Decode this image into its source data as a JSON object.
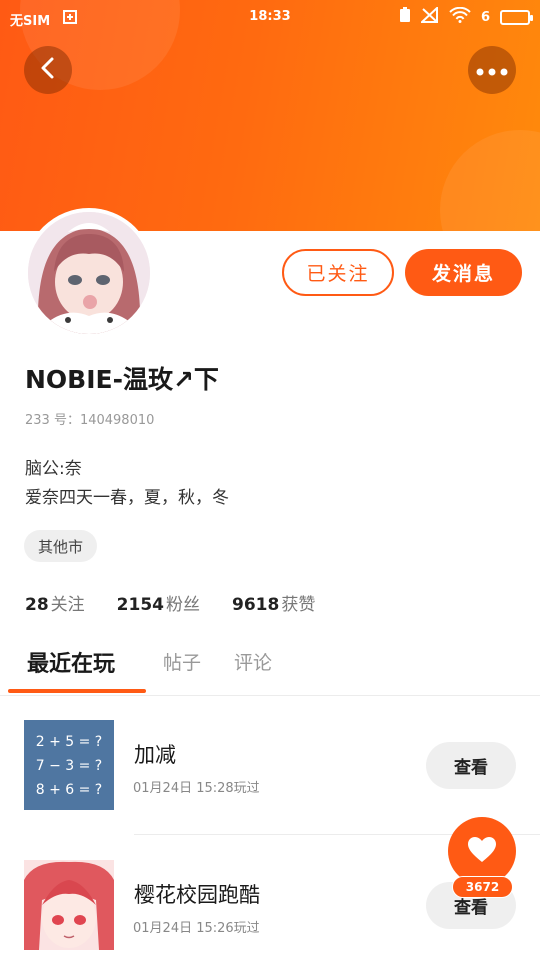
{
  "status_bar": {
    "carrier": "无SIM",
    "time": "18:33",
    "battery_level": "6"
  },
  "profile": {
    "username": "NOBIE-温玫↗下",
    "uid": "233 号：140498010",
    "bio_line1": "脑公:奈",
    "bio_line2": "爱奈四天一春，夏，秋，冬",
    "location": "其他市",
    "follow_count": "28",
    "follow_label": "关注",
    "fans_count": "2154",
    "fans_label": "粉丝",
    "likes_count": "9618",
    "likes_label": "获赞"
  },
  "actions": {
    "followed_label": "已关注",
    "message_label": "发消息"
  },
  "tabs": [
    {
      "label": "最近在玩",
      "active": true
    },
    {
      "label": "帖子",
      "active": false
    },
    {
      "label": "评论",
      "active": false
    }
  ],
  "games": [
    {
      "title": "加减",
      "time": "01月24日 15:28玩过",
      "button": "查看",
      "thumb_lines": [
        "2 + 5 = ?",
        "7 − 3 = ?",
        "8 + 6 = ?"
      ]
    },
    {
      "title": "樱花校园跑酷",
      "time": "01月24日 15:26玩过",
      "button": "查看"
    }
  ],
  "like_fab": {
    "count": "3672"
  },
  "colors": {
    "accent": "#ff5a14",
    "header_end": "#ff8a0c",
    "thumb_math_bg": "#4f76a1"
  }
}
